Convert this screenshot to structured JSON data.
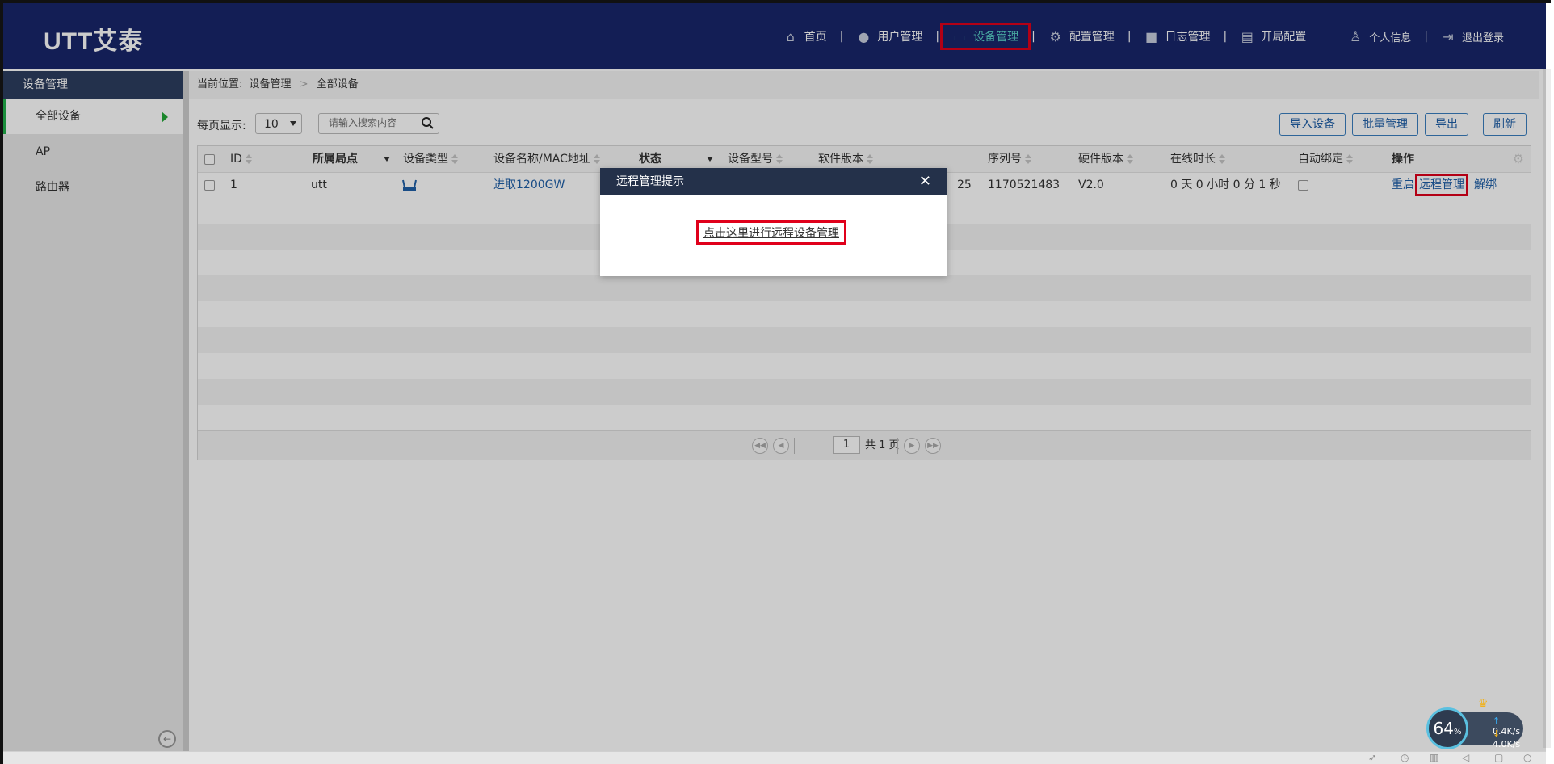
{
  "header": {
    "logo": "UTT艾泰",
    "nav": [
      {
        "label": "首页",
        "icon": "home-icon"
      },
      {
        "label": "用户管理",
        "icon": "user-icon"
      },
      {
        "label": "设备管理",
        "icon": "device-icon",
        "active": true
      },
      {
        "label": "配置管理",
        "icon": "gears-icon"
      },
      {
        "label": "日志管理",
        "icon": "box-icon"
      },
      {
        "label": "开局配置",
        "icon": "setup-icon"
      }
    ],
    "separator": "|",
    "profile_label": "个人信息",
    "logout_label": "退出登录"
  },
  "sidebar": {
    "title": "设备管理",
    "items": [
      {
        "label": "全部设备",
        "active": true
      },
      {
        "label": "AP"
      },
      {
        "label": "路由器"
      }
    ]
  },
  "breadcrumb": {
    "prefix": "当前位置:",
    "level1": "设备管理",
    "level2": "全部设备",
    "separator": ">"
  },
  "toolbar": {
    "per_page_label": "每页显示:",
    "per_page_value": "10",
    "search_placeholder": "请输入搜索内容",
    "buttons": [
      "导入设备",
      "批量管理",
      "导出",
      "刷新"
    ]
  },
  "table": {
    "columns": [
      "ID",
      "所属局点",
      "设备类型",
      "设备名称/MAC地址",
      "状态",
      "设备型号",
      "软件版本",
      "序列号",
      "硬件版本",
      "在线时长",
      "自动绑定",
      "操作"
    ],
    "rows": [
      {
        "id": "1",
        "site": "utt",
        "device_type_icon": "router-icon",
        "name": "进取1200GW",
        "status": "",
        "model": "",
        "software_tail": "25",
        "serial": "1170521483",
        "hardware": "V2.0",
        "online": "0 天 0 小时 0 分 1 秒",
        "actions": [
          "重启",
          "远程管理",
          "解绑"
        ]
      }
    ]
  },
  "pager": {
    "current_page": "1",
    "total_text": "共 1 页"
  },
  "modal": {
    "title": "远程管理提示",
    "close": "✕",
    "link_text": "点击这里进行远程设备管理"
  },
  "speed_widget": {
    "percent": "64",
    "percent_unit": "%",
    "up": "0.4K/s",
    "down": "4.0K/s",
    "accent_color": "#5ac0e0"
  },
  "colors": {
    "header_bg": "#18266b",
    "nav_active": "#5ad1c8",
    "highlight_border": "#e0001b",
    "link": "#1f5fa8",
    "sidebar_active_bar": "#21b24b"
  }
}
